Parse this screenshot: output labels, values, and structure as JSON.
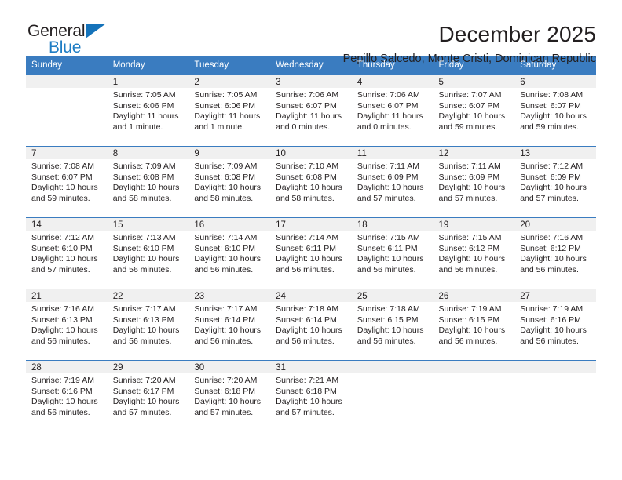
{
  "logo": {
    "word_top": "General",
    "word_bottom": "Blue",
    "triangle_color": "#1573ba",
    "blue_text_color": "#1f7dc4"
  },
  "header": {
    "title": "December 2025",
    "subtitle": "Pepillo Salcedo, Monte Cristi, Dominican Republic"
  },
  "theme": {
    "header_blue": "#3a7cc0",
    "daynum_band": "#f0f0f0",
    "text": "#231f20"
  },
  "weekdays": [
    "Sunday",
    "Monday",
    "Tuesday",
    "Wednesday",
    "Thursday",
    "Friday",
    "Saturday"
  ],
  "weeks": [
    [
      {
        "day": "",
        "sunrise": "",
        "sunset": "",
        "daylight": "",
        "daylight2": ""
      },
      {
        "day": "1",
        "sunrise": "Sunrise: 7:05 AM",
        "sunset": "Sunset: 6:06 PM",
        "daylight": "Daylight: 11 hours",
        "daylight2": "and 1 minute."
      },
      {
        "day": "2",
        "sunrise": "Sunrise: 7:05 AM",
        "sunset": "Sunset: 6:06 PM",
        "daylight": "Daylight: 11 hours",
        "daylight2": "and 1 minute."
      },
      {
        "day": "3",
        "sunrise": "Sunrise: 7:06 AM",
        "sunset": "Sunset: 6:07 PM",
        "daylight": "Daylight: 11 hours",
        "daylight2": "and 0 minutes."
      },
      {
        "day": "4",
        "sunrise": "Sunrise: 7:06 AM",
        "sunset": "Sunset: 6:07 PM",
        "daylight": "Daylight: 11 hours",
        "daylight2": "and 0 minutes."
      },
      {
        "day": "5",
        "sunrise": "Sunrise: 7:07 AM",
        "sunset": "Sunset: 6:07 PM",
        "daylight": "Daylight: 10 hours",
        "daylight2": "and 59 minutes."
      },
      {
        "day": "6",
        "sunrise": "Sunrise: 7:08 AM",
        "sunset": "Sunset: 6:07 PM",
        "daylight": "Daylight: 10 hours",
        "daylight2": "and 59 minutes."
      }
    ],
    [
      {
        "day": "7",
        "sunrise": "Sunrise: 7:08 AM",
        "sunset": "Sunset: 6:07 PM",
        "daylight": "Daylight: 10 hours",
        "daylight2": "and 59 minutes."
      },
      {
        "day": "8",
        "sunrise": "Sunrise: 7:09 AM",
        "sunset": "Sunset: 6:08 PM",
        "daylight": "Daylight: 10 hours",
        "daylight2": "and 58 minutes."
      },
      {
        "day": "9",
        "sunrise": "Sunrise: 7:09 AM",
        "sunset": "Sunset: 6:08 PM",
        "daylight": "Daylight: 10 hours",
        "daylight2": "and 58 minutes."
      },
      {
        "day": "10",
        "sunrise": "Sunrise: 7:10 AM",
        "sunset": "Sunset: 6:08 PM",
        "daylight": "Daylight: 10 hours",
        "daylight2": "and 58 minutes."
      },
      {
        "day": "11",
        "sunrise": "Sunrise: 7:11 AM",
        "sunset": "Sunset: 6:09 PM",
        "daylight": "Daylight: 10 hours",
        "daylight2": "and 57 minutes."
      },
      {
        "day": "12",
        "sunrise": "Sunrise: 7:11 AM",
        "sunset": "Sunset: 6:09 PM",
        "daylight": "Daylight: 10 hours",
        "daylight2": "and 57 minutes."
      },
      {
        "day": "13",
        "sunrise": "Sunrise: 7:12 AM",
        "sunset": "Sunset: 6:09 PM",
        "daylight": "Daylight: 10 hours",
        "daylight2": "and 57 minutes."
      }
    ],
    [
      {
        "day": "14",
        "sunrise": "Sunrise: 7:12 AM",
        "sunset": "Sunset: 6:10 PM",
        "daylight": "Daylight: 10 hours",
        "daylight2": "and 57 minutes."
      },
      {
        "day": "15",
        "sunrise": "Sunrise: 7:13 AM",
        "sunset": "Sunset: 6:10 PM",
        "daylight": "Daylight: 10 hours",
        "daylight2": "and 56 minutes."
      },
      {
        "day": "16",
        "sunrise": "Sunrise: 7:14 AM",
        "sunset": "Sunset: 6:10 PM",
        "daylight": "Daylight: 10 hours",
        "daylight2": "and 56 minutes."
      },
      {
        "day": "17",
        "sunrise": "Sunrise: 7:14 AM",
        "sunset": "Sunset: 6:11 PM",
        "daylight": "Daylight: 10 hours",
        "daylight2": "and 56 minutes."
      },
      {
        "day": "18",
        "sunrise": "Sunrise: 7:15 AM",
        "sunset": "Sunset: 6:11 PM",
        "daylight": "Daylight: 10 hours",
        "daylight2": "and 56 minutes."
      },
      {
        "day": "19",
        "sunrise": "Sunrise: 7:15 AM",
        "sunset": "Sunset: 6:12 PM",
        "daylight": "Daylight: 10 hours",
        "daylight2": "and 56 minutes."
      },
      {
        "day": "20",
        "sunrise": "Sunrise: 7:16 AM",
        "sunset": "Sunset: 6:12 PM",
        "daylight": "Daylight: 10 hours",
        "daylight2": "and 56 minutes."
      }
    ],
    [
      {
        "day": "21",
        "sunrise": "Sunrise: 7:16 AM",
        "sunset": "Sunset: 6:13 PM",
        "daylight": "Daylight: 10 hours",
        "daylight2": "and 56 minutes."
      },
      {
        "day": "22",
        "sunrise": "Sunrise: 7:17 AM",
        "sunset": "Sunset: 6:13 PM",
        "daylight": "Daylight: 10 hours",
        "daylight2": "and 56 minutes."
      },
      {
        "day": "23",
        "sunrise": "Sunrise: 7:17 AM",
        "sunset": "Sunset: 6:14 PM",
        "daylight": "Daylight: 10 hours",
        "daylight2": "and 56 minutes."
      },
      {
        "day": "24",
        "sunrise": "Sunrise: 7:18 AM",
        "sunset": "Sunset: 6:14 PM",
        "daylight": "Daylight: 10 hours",
        "daylight2": "and 56 minutes."
      },
      {
        "day": "25",
        "sunrise": "Sunrise: 7:18 AM",
        "sunset": "Sunset: 6:15 PM",
        "daylight": "Daylight: 10 hours",
        "daylight2": "and 56 minutes."
      },
      {
        "day": "26",
        "sunrise": "Sunrise: 7:19 AM",
        "sunset": "Sunset: 6:15 PM",
        "daylight": "Daylight: 10 hours",
        "daylight2": "and 56 minutes."
      },
      {
        "day": "27",
        "sunrise": "Sunrise: 7:19 AM",
        "sunset": "Sunset: 6:16 PM",
        "daylight": "Daylight: 10 hours",
        "daylight2": "and 56 minutes."
      }
    ],
    [
      {
        "day": "28",
        "sunrise": "Sunrise: 7:19 AM",
        "sunset": "Sunset: 6:16 PM",
        "daylight": "Daylight: 10 hours",
        "daylight2": "and 56 minutes."
      },
      {
        "day": "29",
        "sunrise": "Sunrise: 7:20 AM",
        "sunset": "Sunset: 6:17 PM",
        "daylight": "Daylight: 10 hours",
        "daylight2": "and 57 minutes."
      },
      {
        "day": "30",
        "sunrise": "Sunrise: 7:20 AM",
        "sunset": "Sunset: 6:18 PM",
        "daylight": "Daylight: 10 hours",
        "daylight2": "and 57 minutes."
      },
      {
        "day": "31",
        "sunrise": "Sunrise: 7:21 AM",
        "sunset": "Sunset: 6:18 PM",
        "daylight": "Daylight: 10 hours",
        "daylight2": "and 57 minutes."
      },
      {
        "day": "",
        "sunrise": "",
        "sunset": "",
        "daylight": "",
        "daylight2": ""
      },
      {
        "day": "",
        "sunrise": "",
        "sunset": "",
        "daylight": "",
        "daylight2": ""
      },
      {
        "day": "",
        "sunrise": "",
        "sunset": "",
        "daylight": "",
        "daylight2": ""
      }
    ]
  ]
}
